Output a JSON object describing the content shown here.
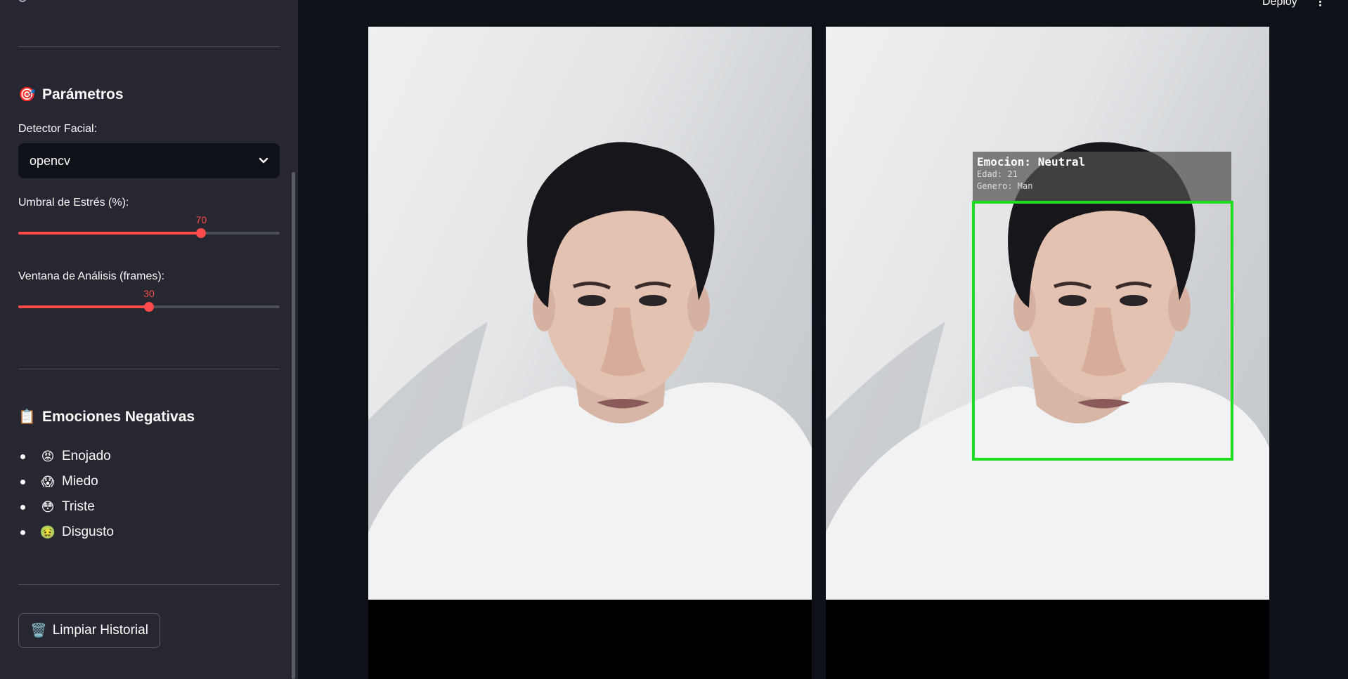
{
  "sidebar": {
    "parameters_section": {
      "icon": "target-icon",
      "emoji": "🎯",
      "title": "Parámetros"
    },
    "face_detector": {
      "label": "Detector Facial:",
      "value": "opencv"
    },
    "stress_threshold": {
      "label": "Umbral de Estrés (%):",
      "value": "70",
      "fraction": 0.7
    },
    "analysis_window": {
      "label": "Ventana de Análisis (frames):",
      "value": "30",
      "fraction": 0.5
    },
    "negative_emotions_section": {
      "icon": "clipboard-icon",
      "emoji": "📋",
      "title": "Emociones Negativas"
    },
    "negative_emotions": [
      {
        "icon": "angry-face-icon",
        "emoji": "😡",
        "label": "Enojado"
      },
      {
        "icon": "fearful-face-icon",
        "emoji": "😱",
        "label": "Miedo"
      },
      {
        "icon": "flushed-face-icon",
        "emoji": "😳",
        "label": "Triste"
      },
      {
        "icon": "nauseated-face-icon",
        "emoji": "🤢",
        "label": "Disgusto"
      }
    ],
    "clear_button": {
      "icon": "trash-icon",
      "emoji": "🗑️",
      "label": "Limpiar Historial"
    }
  },
  "header": {
    "deploy_label": "Deploy",
    "menu_icon": "kebab-menu-icon"
  },
  "main": {
    "detection_overlay": {
      "emotion_text": "Emocion: Neutral",
      "age_text": "Edad: 21",
      "gender_text": "Genero: Man"
    }
  },
  "colors": {
    "accent": "#ff4b4b",
    "sidebar_bg": "#262730",
    "main_bg": "#0e1117",
    "face_box": "#1fdc1f"
  }
}
